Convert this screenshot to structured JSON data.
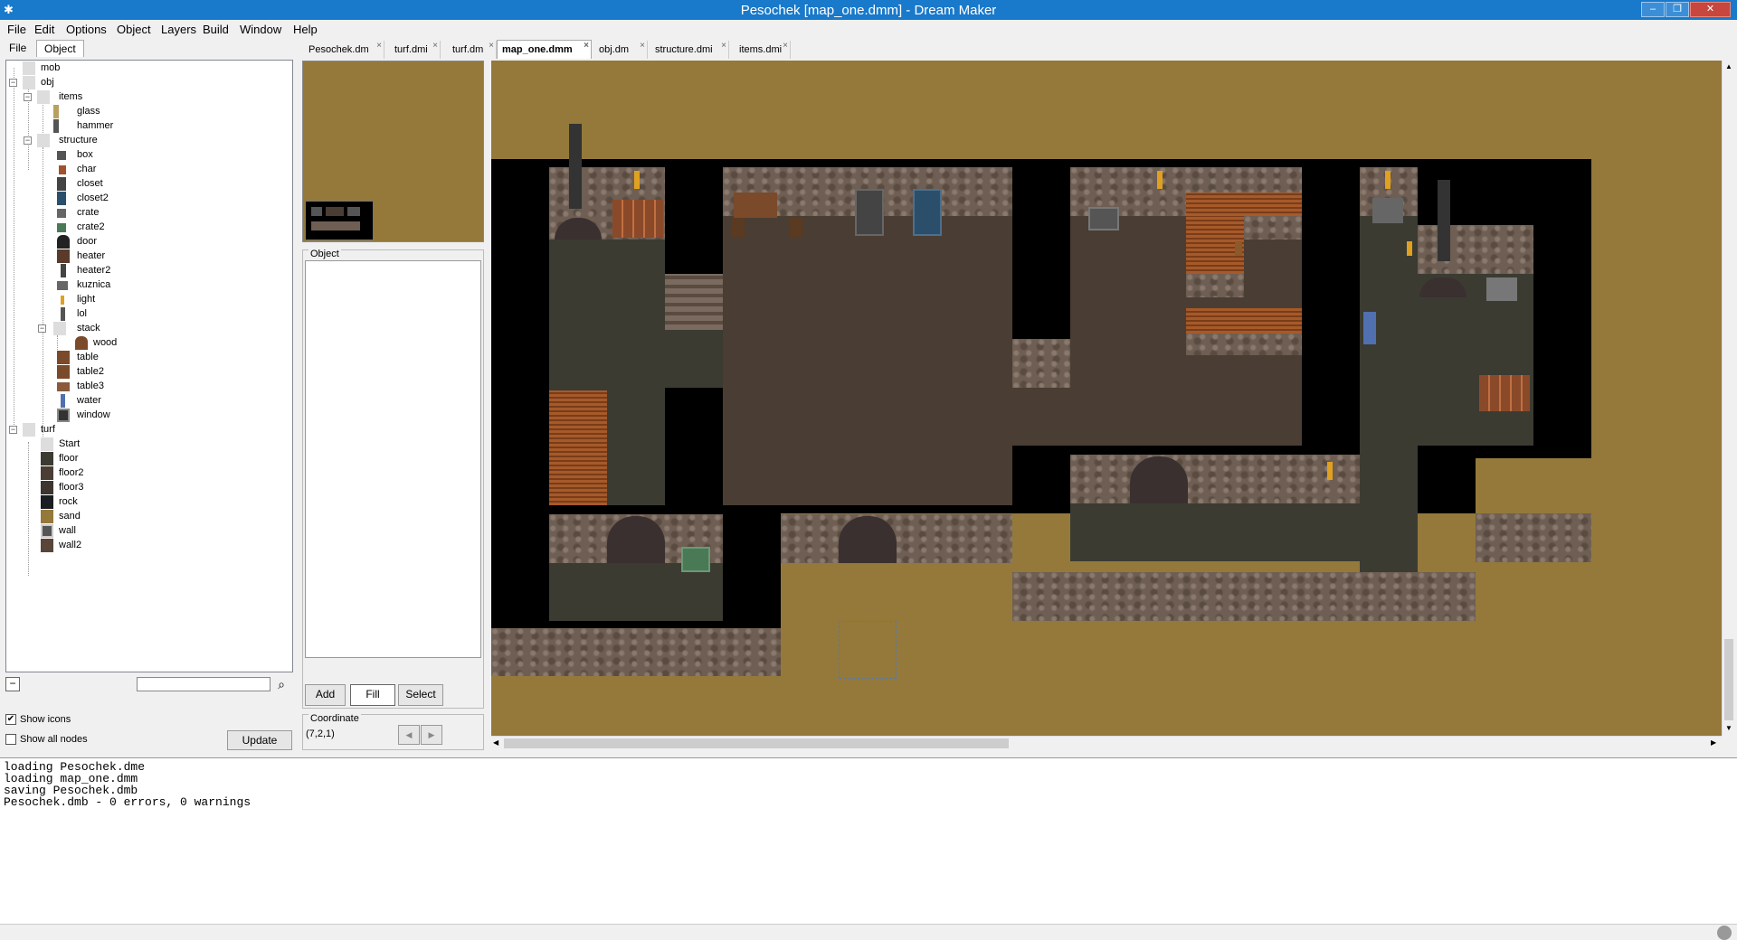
{
  "window": {
    "title": "Pesochek [map_one.dmm] - Dream Maker",
    "minimize": "–",
    "restore": "❐",
    "close": "✕"
  },
  "menu": [
    "File",
    "Edit",
    "Options",
    "Object",
    "Layers",
    "Build",
    "Window",
    "Help"
  ],
  "left_tabs": [
    "File",
    "Object"
  ],
  "tree": [
    {
      "label": "mob"
    },
    {
      "label": "obj"
    },
    {
      "label": "items"
    },
    {
      "label": "glass"
    },
    {
      "label": "hammer"
    },
    {
      "label": "structure"
    },
    {
      "label": "box"
    },
    {
      "label": "char"
    },
    {
      "label": "closet"
    },
    {
      "label": "closet2"
    },
    {
      "label": "crate"
    },
    {
      "label": "crate2"
    },
    {
      "label": "door"
    },
    {
      "label": "heater"
    },
    {
      "label": "heater2"
    },
    {
      "label": "kuznica"
    },
    {
      "label": "light"
    },
    {
      "label": "lol"
    },
    {
      "label": "stack"
    },
    {
      "label": "wood"
    },
    {
      "label": "table"
    },
    {
      "label": "table2"
    },
    {
      "label": "table3"
    },
    {
      "label": "water"
    },
    {
      "label": "window"
    },
    {
      "label": "turf"
    },
    {
      "label": "Start"
    },
    {
      "label": "floor"
    },
    {
      "label": "floor2"
    },
    {
      "label": "floor3"
    },
    {
      "label": "rock"
    },
    {
      "label": "sand"
    },
    {
      "label": "wall"
    },
    {
      "label": "wall2"
    }
  ],
  "tree_controls": {
    "search_value": "",
    "show_icons": "Show icons",
    "show_icons_checked": "✔",
    "show_all_nodes": "Show all nodes",
    "update": "Update"
  },
  "file_tabs": [
    "Pesochek.dm",
    "turf.dmi",
    "turf.dm",
    "map_one.dmm",
    "obj.dm",
    "structure.dmi",
    "items.dmi"
  ],
  "file_tab_close": "×",
  "object_panel": {
    "label": "Object",
    "add": "Add",
    "fill": "Fill",
    "select": "Select"
  },
  "coordinate": {
    "label": "Coordinate",
    "value": "(7,2,1)",
    "prev": "◀",
    "next": "▶"
  },
  "output": [
    "loading Pesochek.dme",
    "loading map_one.dmm",
    "saving Pesochek.dmb",
    "Pesochek.dmb - 0 errors, 0 warnings"
  ],
  "colors": {
    "titlebar": "#1979ca",
    "sand": "#94793b",
    "void": "#000000"
  }
}
